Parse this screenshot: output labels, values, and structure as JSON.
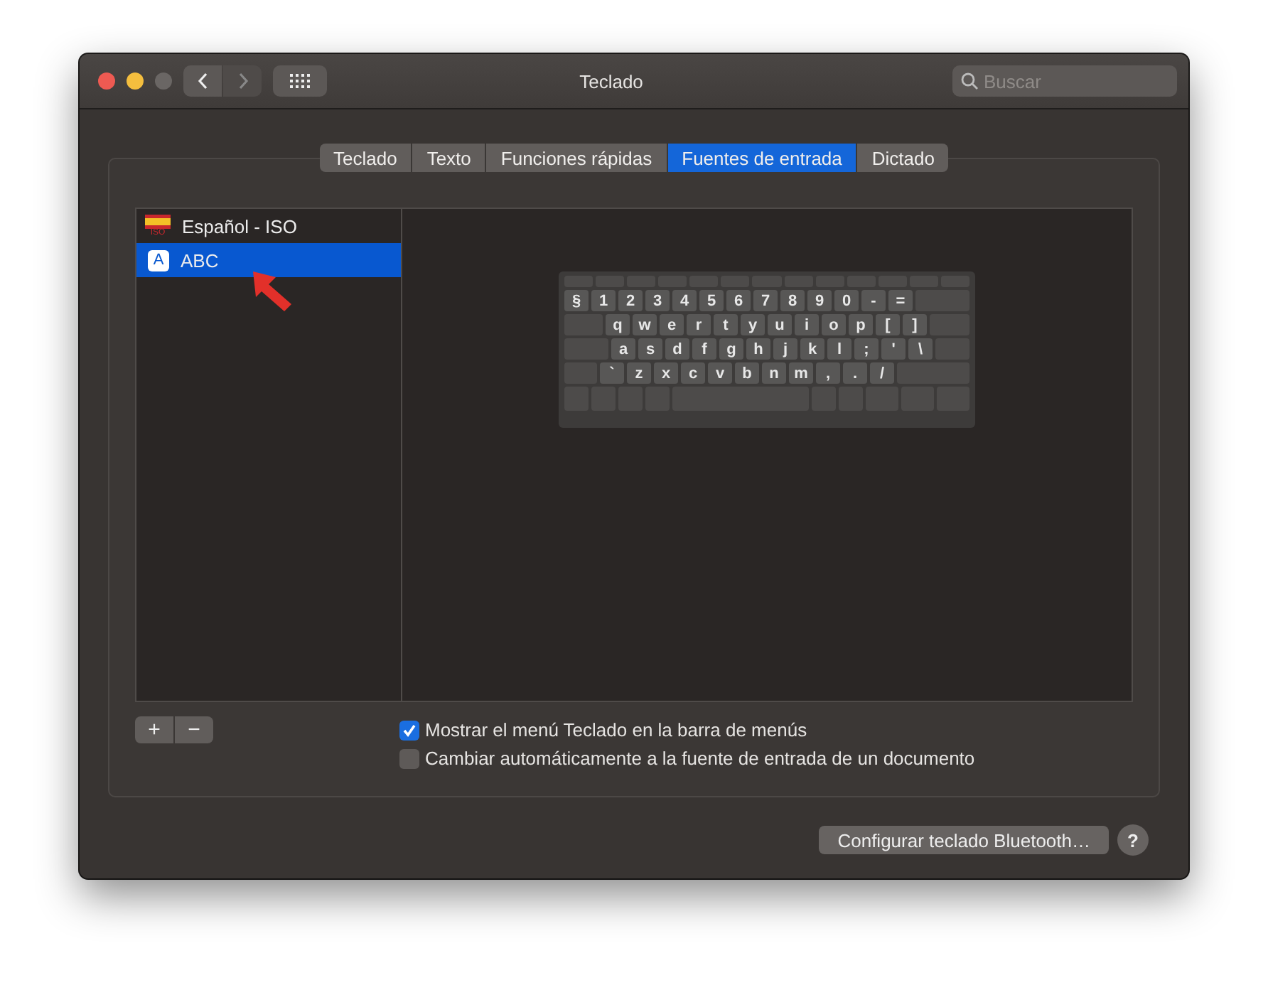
{
  "window": {
    "title": "Teclado",
    "search": {
      "placeholder": "Buscar"
    }
  },
  "tabs": [
    {
      "label": "Teclado",
      "selected": false
    },
    {
      "label": "Texto",
      "selected": false
    },
    {
      "label": "Funciones rápidas",
      "selected": false
    },
    {
      "label": "Fuentes de entrada",
      "selected": true
    },
    {
      "label": "Dictado",
      "selected": false
    }
  ],
  "sources": [
    {
      "label": "Español - ISO",
      "kind": "flag",
      "flag_text": "ISO",
      "selected": false
    },
    {
      "label": "ABC",
      "kind": "letter",
      "icon_text": "A",
      "selected": true
    }
  ],
  "list_buttons": [
    "+",
    "−"
  ],
  "keyboard": {
    "rows": [
      {
        "keys": [
          "§",
          "1",
          "2",
          "3",
          "4",
          "5",
          "6",
          "7",
          "8",
          "9",
          "0",
          "-",
          "="
        ]
      },
      {
        "keys": [
          "q",
          "w",
          "e",
          "r",
          "t",
          "y",
          "u",
          "i",
          "o",
          "p",
          "[",
          "]"
        ]
      },
      {
        "keys": [
          "a",
          "s",
          "d",
          "f",
          "g",
          "h",
          "j",
          "k",
          "l",
          ";",
          "'",
          "\\"
        ]
      },
      {
        "keys": [
          "`",
          "z",
          "x",
          "c",
          "v",
          "b",
          "n",
          "m",
          ",",
          ".",
          "/"
        ]
      }
    ]
  },
  "options": [
    {
      "label": "Mostrar el menú Teclado en la barra de menús",
      "checked": true
    },
    {
      "label": "Cambiar automáticamente a la fuente de entrada de un documento",
      "checked": false
    }
  ],
  "bluetooth_button": "Configurar teclado Bluetooth…",
  "help_button": "?"
}
